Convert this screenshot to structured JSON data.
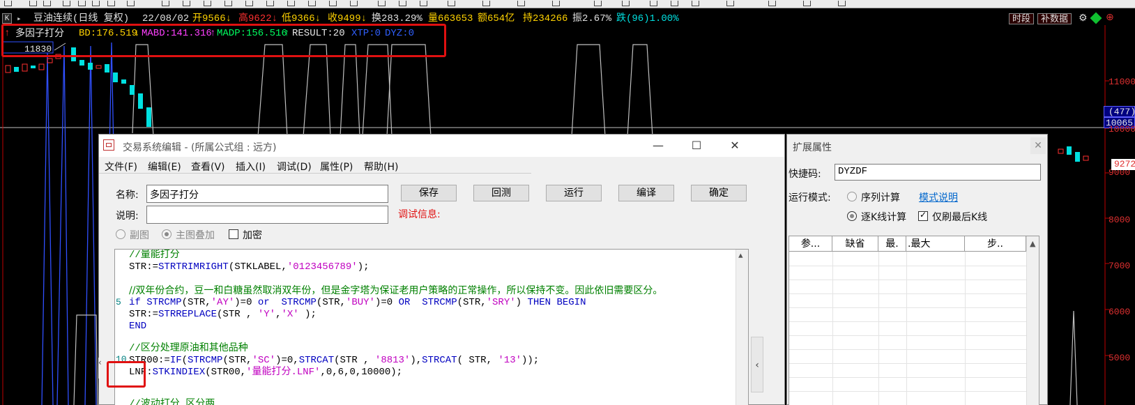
{
  "quote_line": {
    "title": "豆油连续(日线 复权)",
    "date": "22/08/02",
    "open": "开9566↓",
    "high": "高9622↓",
    "low": "低9366↓",
    "close": "收9499↓",
    "turnover_rate": "换283.29%",
    "volume": "量663653",
    "amount": "额654亿",
    "open_interest": "持234266",
    "amplitude": "振2.67%",
    "change": "跌(96)1.00%",
    "k_label": "K"
  },
  "top_buttons": {
    "period": "时段",
    "supplement": "补数据"
  },
  "indicator": {
    "name": "多因子打分",
    "bd": "BD:176.519",
    "mabd": "MABD:141.316",
    "madp": "MADP:156.516",
    "result": "RESULT:20",
    "xtp": "XTP:0",
    "dyz": "DYZ:0",
    "level_label": "11830"
  },
  "price_axis": {
    "labels": [
      "11000",
      "10000",
      "9000",
      "8000",
      "7000",
      "6000",
      "5000"
    ],
    "badge_477": "(477)",
    "badge_10065": "10065",
    "badge_9272": "9272"
  },
  "dialog": {
    "title": "交易系统编辑 - (所属公式组 : 远方)",
    "menu": [
      "文件(F)",
      "编辑(E)",
      "查看(V)",
      "插入(I)",
      "调试(D)",
      "属性(P)",
      "帮助(H)"
    ],
    "name_label": "名称:",
    "name_value": "多因子打分",
    "desc_label": "说明:",
    "desc_value": "",
    "debug_label": "调试信息:",
    "buttons": {
      "save": "保存",
      "backtest": "回测",
      "run": "运行",
      "compile": "编译",
      "ok": "确定"
    },
    "radio_sub": "副图",
    "radio_main": "主图叠加",
    "encrypt": "加密",
    "line_numbers": {
      "five": "5",
      "ten": "10"
    },
    "code": {
      "l1": "//量能打分",
      "l2a": "STR:=",
      "l2b": "STRTRIMRIGHT",
      "l2c": "(STKLABEL,",
      "l2d": "'0123456789'",
      "l2e": ");",
      "l3": "//双年份合约，豆一和白糖虽然取消双年份，但是金字塔为保证老用户策略的正常操作，所以保持不变。因此依旧需要区分。",
      "l4a": "if ",
      "l4b": "STRCMP",
      "l4c": "(STR,",
      "l4d": "'AY'",
      "l4e": ")=0 ",
      "l4f": "or",
      "l4g": "  ",
      "l4h": "STRCMP",
      "l4i": "(STR,",
      "l4j": "'BUY'",
      "l4k": ")=0 ",
      "l4l": "OR",
      "l4m": "  ",
      "l4n": "STRCMP",
      "l4o": "(STR,",
      "l4p": "'SRY'",
      "l4q": ") ",
      "l4r": "THEN BEGIN",
      "l5a": "STR:=",
      "l5b": "STRREPLACE",
      "l5c": "(STR , ",
      "l5d": "'Y'",
      "l5e": ",",
      "l5f": "'X'",
      "l5g": " );",
      "l6": "END",
      "l7": "//区分处理原油和其他品种",
      "l8a": "STR00:=",
      "l8b": "IF",
      "l8c": "(",
      "l8d": "STRCMP",
      "l8e": "(STR,",
      "l8f": "'SC'",
      "l8g": ")=0,",
      "l8h": "STRCAT",
      "l8i": "(STR , ",
      "l8j": "'8813'",
      "l8k": "),",
      "l8l": "STRCAT",
      "l8m": "( STR, ",
      "l8n": "'13'",
      "l8o": "));",
      "l9a": "LNF:",
      "l9b": "STKINDIEX",
      "l9c": "(STR00,",
      "l9d": "'量能打分.LNF'",
      "l9e": ",0,6,0,10000);",
      "l10": "//波动打分 区分两",
      "l10_prefix": "//波动打分 区分两面"
    }
  },
  "side_panel": {
    "title": "扩展属性",
    "shortcut_label": "快捷码:",
    "shortcut_value": "DYZDF",
    "mode_label": "运行模式:",
    "mode_sequence": "序列计算",
    "mode_help": "模式说明",
    "mode_kline": "逐K线计算",
    "only_last": "仅刷最后K线",
    "table_headers": [
      "参...",
      "缺省",
      "最.",
      ".最大",
      "步.."
    ]
  }
}
